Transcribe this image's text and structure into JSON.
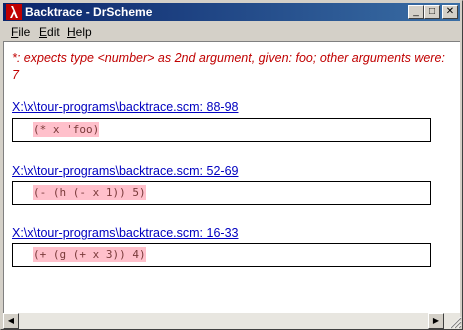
{
  "window": {
    "title": "Backtrace - DrScheme",
    "minimize_glyph": "_",
    "maximize_glyph": "□",
    "close_glyph": "✕"
  },
  "menu": [
    {
      "label": "File"
    },
    {
      "label": "Edit"
    },
    {
      "label": "Help"
    }
  ],
  "error": {
    "message": "*: expects type <number> as 2nd argument, given: foo; other arguments were: 7"
  },
  "frames": [
    {
      "location": "X:\\x\\tour-programs\\backtrace.scm: 88-98",
      "code": "(* x 'foo)"
    },
    {
      "location": "X:\\x\\tour-programs\\backtrace.scm: 52-69",
      "code": "(- (h (- x 1)) 5)"
    },
    {
      "location": "X:\\x\\tour-programs\\backtrace.scm: 16-33",
      "code": "(+ (g (+ x 3)) 4)"
    }
  ],
  "scrollbar": {
    "left_arrow": "◀",
    "right_arrow": "▶"
  },
  "colors": {
    "titlebar_start": "#0a246a",
    "titlebar_end": "#3a6ea5",
    "error_text": "#c00000",
    "link_text": "#0000c0",
    "code_highlight": "#ffc0cb"
  }
}
